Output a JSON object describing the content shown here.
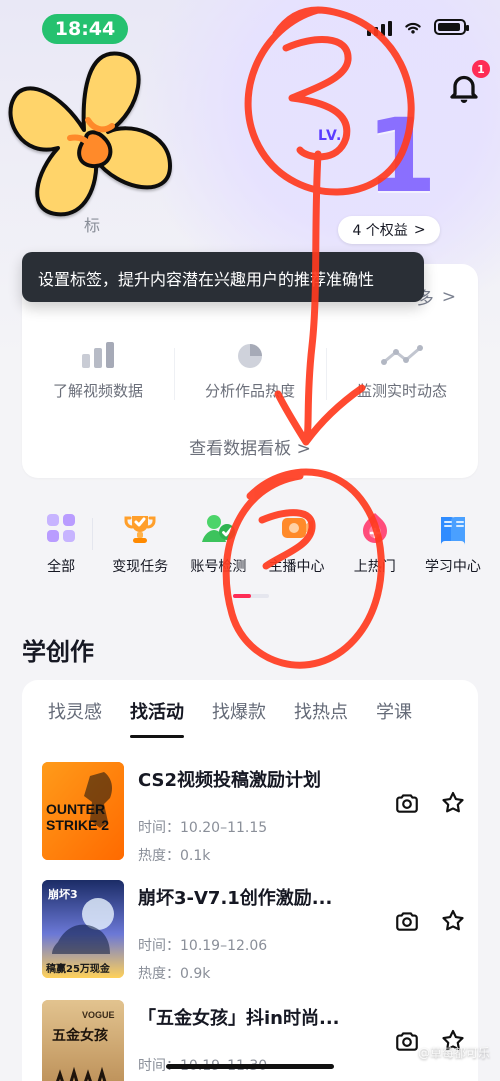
{
  "status_bar": {
    "time": "18:44"
  },
  "notifications": {
    "count": "1"
  },
  "level": {
    "prefix": "LV.",
    "number": "1"
  },
  "benefit_pill": {
    "label": "4 个权益",
    "chevron": ">"
  },
  "sticker_partial_text": "标",
  "tooltip": {
    "text": "设置标签，提升内容潜在兴趣用户的推荐准确性"
  },
  "data_card": {
    "more_label": "多",
    "more_chevron": ">",
    "items": [
      {
        "icon": "bar-chart-icon",
        "label": "了解视频数据"
      },
      {
        "icon": "pie-chart-icon",
        "label": "分析作品热度"
      },
      {
        "icon": "trend-icon",
        "label": "监测实时动态"
      }
    ],
    "view_board": "查看数据看板 >"
  },
  "shortcuts": [
    {
      "icon": "grid-icon",
      "label": "全部"
    },
    {
      "icon": "trophy-icon",
      "label": "变现任务"
    },
    {
      "icon": "user-check-icon",
      "label": "账号检测"
    },
    {
      "icon": "camera-icon",
      "label": "主播中心"
    },
    {
      "icon": "fire-plus-icon",
      "label": "上热门"
    },
    {
      "icon": "book-icon",
      "label": "学习中心"
    }
  ],
  "shortcut_pager": {
    "active_index": 0,
    "pages": 2
  },
  "learn": {
    "title": "学创作",
    "tabs": [
      "找灵感",
      "找活动",
      "找爆款",
      "找热点",
      "学课"
    ],
    "active_tab": 1,
    "activities": [
      {
        "title": "CS2视频投稿激励计划",
        "time_label": "时间：10.20–11.15",
        "heat_label": "热度：0.1k",
        "thumb_text_1": "OUNTER",
        "thumb_text_2": "STRIKE 2"
      },
      {
        "title": "崩坏3-V7.1创作激励...",
        "time_label": "时间：10.19–12.06",
        "heat_label": "热度：0.9k",
        "thumb_text_1": "崩坏3",
        "thumb_text_2": "稿赢25万现金"
      },
      {
        "title": "「五金女孩」抖in时尚...",
        "time_label": "时间：10.19–11.30",
        "heat_label": "",
        "thumb_text_1": "VOGUE",
        "thumb_text_2": "五金女孩"
      }
    ]
  },
  "colors": {
    "accent": "#fe2c55",
    "status_green": "#25c16f",
    "annotation_red": "#ff3b1f"
  },
  "watermark": "@草莓都可乐"
}
